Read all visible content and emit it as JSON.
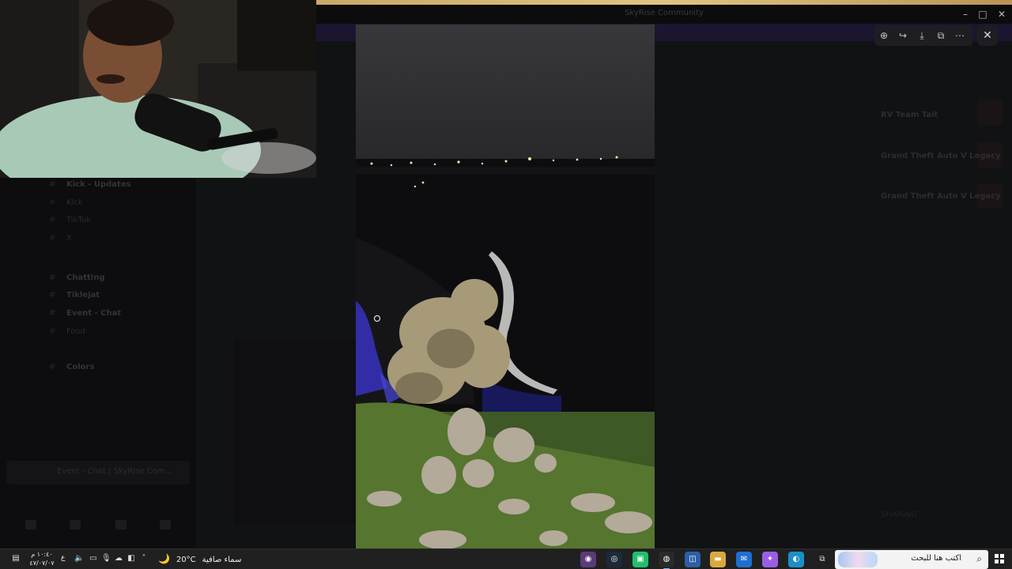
{
  "window": {
    "title": "SkyRise Community"
  },
  "channels": [
    {
      "label": "Kick - Updates",
      "bold": true
    },
    {
      "label": "Kick",
      "bold": false
    },
    {
      "label": "TikTok",
      "bold": false
    },
    {
      "label": "X",
      "bold": false
    },
    {
      "label": "Chatting",
      "bold": true
    },
    {
      "label": "Tiklejat",
      "bold": true
    },
    {
      "label": "Event - Chat",
      "bold": true
    },
    {
      "label": "Food",
      "bold": false
    },
    {
      "label": "Colors",
      "bold": true
    }
  ],
  "voice_status": "Event - Chat | SkyRise Com...",
  "members": [
    {
      "label": "RV Team Tait",
      "bold": true
    },
    {
      "label": "Grand Theft Auto V Legacy",
      "bold": true
    },
    {
      "label": "Grand Theft Auto V Legacy",
      "bold": true
    },
    {
      "label": "SHARING",
      "bold": false
    }
  ],
  "viewer_toolbar": {
    "zoom_icon": "zoom-in",
    "forward_icon": "forward",
    "download_icon": "download",
    "open_icon": "open-in-browser",
    "more_icon": "more",
    "close_label": "✕"
  },
  "taskbar": {
    "time": "١٠:٤٠ م",
    "date": "٤٧/٠٧/٠٧",
    "lang": "ع",
    "weather_desc": "سماء صافية",
    "temperature": "20°C",
    "search_placeholder": "اكتب هنا للبحث"
  }
}
